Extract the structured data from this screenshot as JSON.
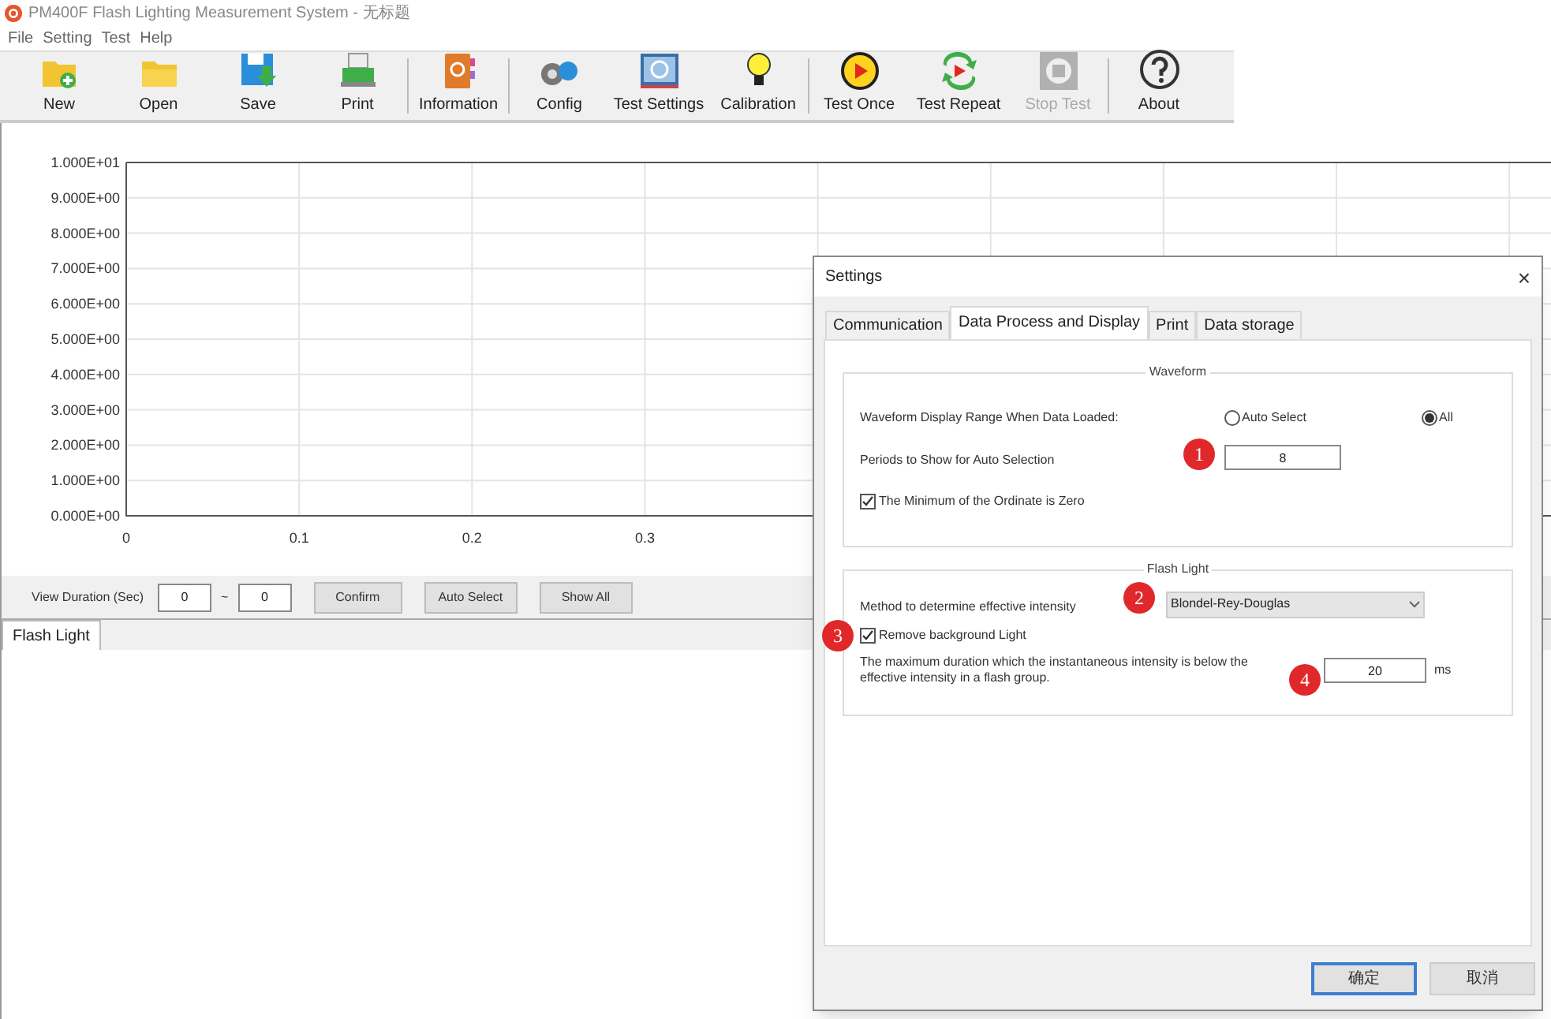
{
  "window": {
    "title": "PM400F Flash Lighting Measurement System - 无标题"
  },
  "menu": [
    "File",
    "Setting",
    "Test",
    "Help"
  ],
  "toolbar": {
    "groups": [
      [
        {
          "label": "New",
          "disabled": false
        },
        {
          "label": "Open",
          "disabled": false
        },
        {
          "label": "Save",
          "disabled": false
        },
        {
          "label": "Print",
          "disabled": false
        }
      ],
      [
        {
          "label": "Information",
          "disabled": false
        }
      ],
      [
        {
          "label": "Config",
          "disabled": false
        },
        {
          "label": "Test Settings",
          "disabled": false
        },
        {
          "label": "Calibration",
          "disabled": false
        }
      ],
      [
        {
          "label": "Test Once",
          "disabled": false
        },
        {
          "label": "Test Repeat",
          "disabled": false
        },
        {
          "label": "Stop Test",
          "disabled": true
        }
      ],
      [
        {
          "label": "About",
          "disabled": false
        }
      ]
    ]
  },
  "chart": {
    "chart_data": {
      "type": "line",
      "grid": true,
      "xlim": [
        0,
        0.825
      ],
      "ylim": [
        0,
        10
      ],
      "xticks": [
        0,
        0.1,
        0.2,
        0.3
      ],
      "yticks": [
        {
          "value": 0,
          "label": "0.000E+00"
        },
        {
          "value": 1,
          "label": "1.000E+00"
        },
        {
          "value": 2,
          "label": "2.000E+00"
        },
        {
          "value": 3,
          "label": "3.000E+00"
        },
        {
          "value": 4,
          "label": "4.000E+00"
        },
        {
          "value": 5,
          "label": "5.000E+00"
        },
        {
          "value": 6,
          "label": "6.000E+00"
        },
        {
          "value": 7,
          "label": "7.000E+00"
        },
        {
          "value": 8,
          "label": "8.000E+00"
        },
        {
          "value": 9,
          "label": "9.000E+00"
        },
        {
          "value": 10,
          "label": "1.000E+01"
        }
      ]
    }
  },
  "view_duration": {
    "label": "View Duration (Sec)",
    "from": "0",
    "separator": "~",
    "to": "0",
    "buttons": [
      "Confirm",
      "Auto Select",
      "Show All"
    ]
  },
  "bottom_tabs": [
    {
      "label": "Flash Light",
      "selected": true
    }
  ],
  "dialog": {
    "title": "Settings",
    "close": "×",
    "tabs": [
      {
        "label": "Communication",
        "selected": false
      },
      {
        "label": "Data Process and Display",
        "selected": true
      },
      {
        "label": "Print",
        "selected": false
      },
      {
        "label": "Data storage",
        "selected": false
      }
    ],
    "waveform": {
      "title": "Waveform",
      "range_label": "Waveform Display Range When Data Loaded:",
      "range_options": [
        {
          "label": "Auto Select",
          "selected": false
        },
        {
          "label": "All",
          "selected": true
        }
      ],
      "periods_label": "Periods to Show for Auto Selection",
      "periods_value": "8",
      "min_zero": {
        "label": "The Minimum of the Ordinate is Zero",
        "checked": true
      }
    },
    "flash_light": {
      "title": "Flash Light",
      "method_label": "Method to determine effective intensity",
      "method_value": "Blondel-Rey-Douglas",
      "remove_background": {
        "label": "Remove background Light",
        "checked": true
      },
      "duration_label": "The maximum duration which the instantaneous intensity is below the effective intensity in a flash group.",
      "duration_value": "20",
      "duration_unit": "ms"
    },
    "markers": [
      "1",
      "2",
      "3",
      "4"
    ],
    "buttons": [
      {
        "label": "确定",
        "default": true
      },
      {
        "label": "取消",
        "default": false
      }
    ]
  }
}
